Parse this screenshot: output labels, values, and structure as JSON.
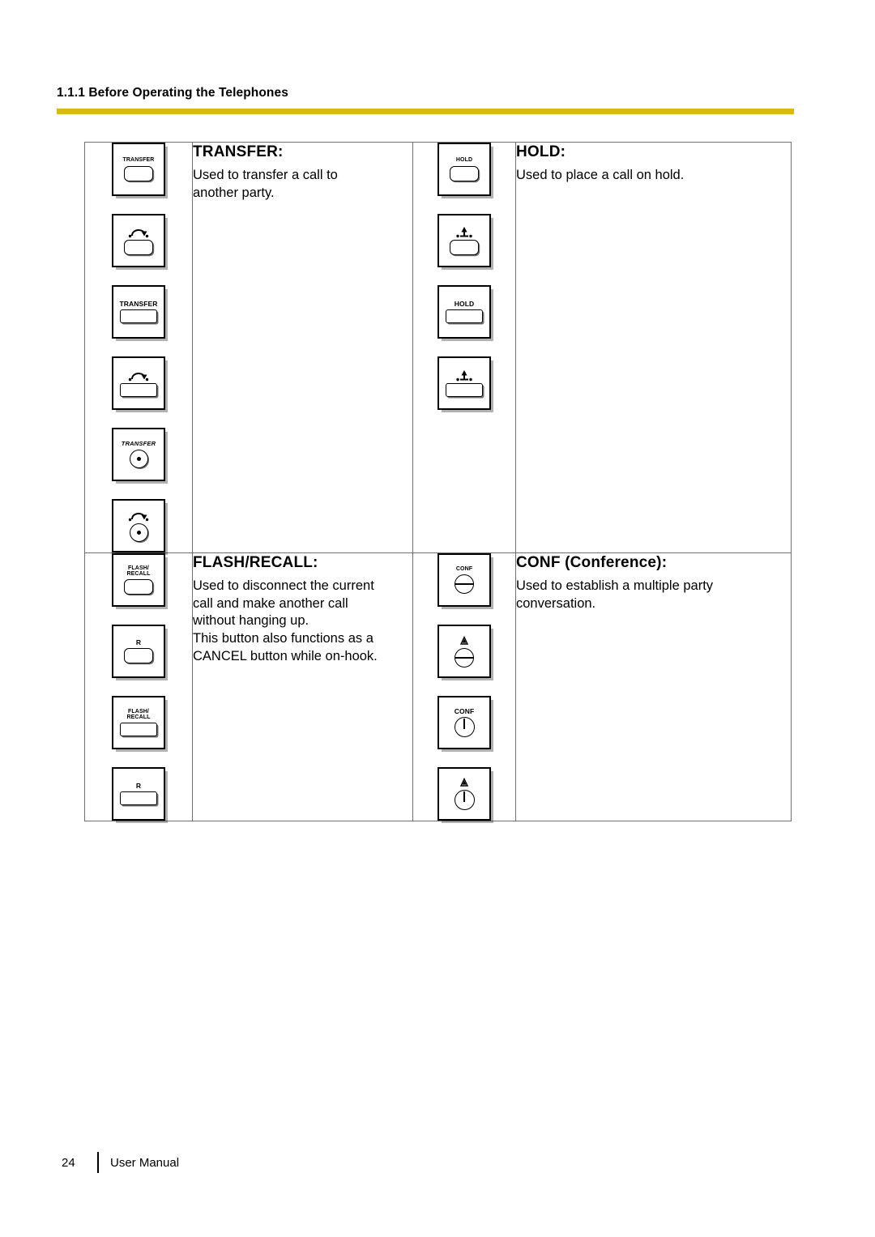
{
  "header": {
    "breadcrumb": "1.1.1 Before Operating the Telephones",
    "rule_color": "#d9ba10"
  },
  "footer": {
    "page_number": "24",
    "document_title": "User Manual"
  },
  "table": {
    "rows": [
      {
        "cells": [
          {
            "section_id": "transfer",
            "title": "TRANSFER:",
            "body_lines": [
              "Used to transfer a call to",
              "another party."
            ],
            "keys": [
              {
                "label": "TRANSFER",
                "label_style": "small",
                "glyph": "none",
                "cap": "cap-round",
                "border": "thick"
              },
              {
                "label": "",
                "label_style": "none",
                "glyph": "transfer-arrow-icon",
                "cap": "cap-round",
                "border": "thick"
              },
              {
                "label": "TRANSFER",
                "label_style": "big",
                "glyph": "none",
                "cap": "cap-wide",
                "border": "thick"
              },
              {
                "label": "",
                "label_style": "none",
                "glyph": "transfer-arrow-icon",
                "cap": "cap-wide",
                "border": "thick"
              },
              {
                "label": "TRANSFER",
                "label_style": "italic",
                "glyph": "none",
                "cap": "cap-dot",
                "border": "thick"
              },
              {
                "label": "",
                "label_style": "none",
                "glyph": "transfer-arrow-icon",
                "cap": "cap-dot",
                "border": "thick"
              }
            ]
          },
          {
            "section_id": "hold",
            "title": "HOLD:",
            "body_lines": [
              "Used to place a call on hold."
            ],
            "keys": [
              {
                "label": "HOLD",
                "label_style": "small",
                "glyph": "none",
                "cap": "cap-round",
                "border": "thick"
              },
              {
                "label": "",
                "label_style": "none",
                "glyph": "hold-arrow-icon",
                "cap": "cap-round",
                "border": "thick"
              },
              {
                "label": "HOLD",
                "label_style": "big",
                "glyph": "none",
                "cap": "cap-wide",
                "border": "thick"
              },
              {
                "label": "",
                "label_style": "none",
                "glyph": "hold-arrow-icon",
                "cap": "cap-wide",
                "border": "thick"
              }
            ]
          }
        ]
      },
      {
        "cells": [
          {
            "section_id": "flash-recall",
            "title": "FLASH/RECALL:",
            "body_lines": [
              "Used to disconnect the current",
              "call and make another call",
              "without hanging up.",
              "This button also functions as a",
              "CANCEL button while on-hook."
            ],
            "keys": [
              {
                "label": "FLASH/\nRECALL",
                "label_style": "small",
                "glyph": "none",
                "cap": "cap-round",
                "border": "thick"
              },
              {
                "label": "R",
                "label_style": "big",
                "glyph": "none",
                "cap": "cap-round",
                "border": "thick"
              },
              {
                "label": "FLASH/\nRECALL",
                "label_style": "small",
                "glyph": "none",
                "cap": "cap-wide",
                "border": "thick"
              },
              {
                "label": "R",
                "label_style": "big",
                "glyph": "none",
                "cap": "cap-wide",
                "border": "thick"
              }
            ]
          },
          {
            "section_id": "conf",
            "title": "CONF (Conference):",
            "body_lines": [
              "Used to establish a multiple party",
              "conversation."
            ],
            "keys": [
              {
                "label": "CONF",
                "label_style": "small",
                "glyph": "none",
                "cap": "cap-bar",
                "border": "thick"
              },
              {
                "label": "",
                "label_style": "none",
                "glyph": "conf-triangle-icon",
                "cap": "cap-bar",
                "border": "thick"
              },
              {
                "label": "CONF",
                "label_style": "big",
                "glyph": "none",
                "cap": "cap-power",
                "border": "thick"
              },
              {
                "label": "",
                "label_style": "none",
                "glyph": "conf-triangle-icon",
                "cap": "cap-power",
                "border": "thick"
              }
            ]
          }
        ]
      }
    ]
  }
}
